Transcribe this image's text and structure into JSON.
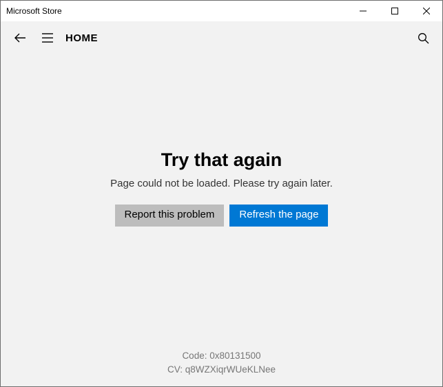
{
  "titlebar": {
    "title": "Microsoft Store"
  },
  "appbar": {
    "page_title": "HOME"
  },
  "error": {
    "heading": "Try that again",
    "message": "Page could not be loaded. Please try again later.",
    "report_label": "Report this problem",
    "refresh_label": "Refresh the page"
  },
  "footer": {
    "code_label": "Code: 0x80131500",
    "cv_label": "CV: q8WZXiqrWUeKLNee"
  },
  "colors": {
    "accent": "#0078d4",
    "page_bg": "#f2f2f2",
    "gray_button": "#bdbdbd"
  }
}
